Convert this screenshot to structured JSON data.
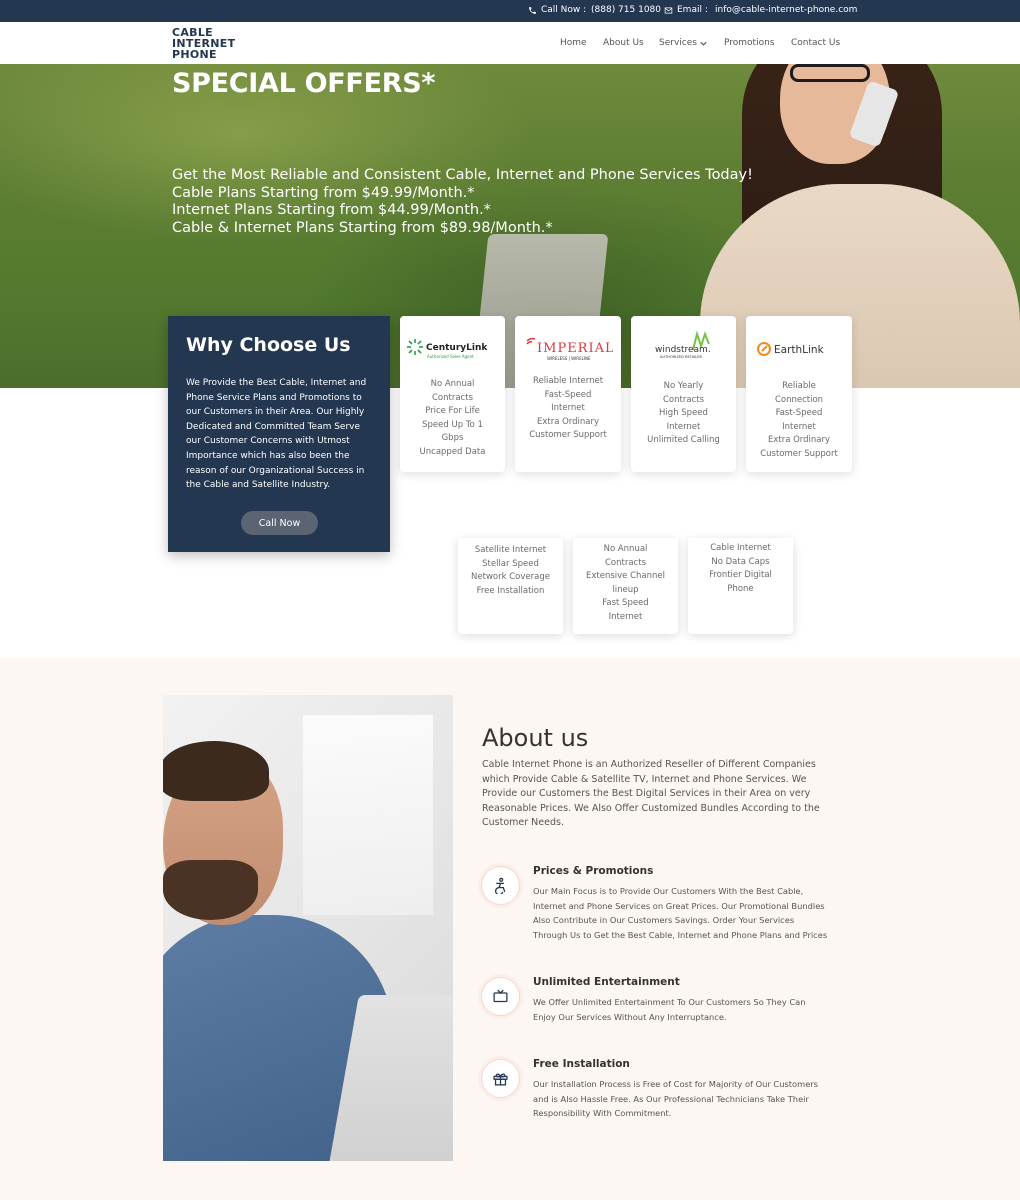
{
  "topbar": {
    "call_label": "Call Now :",
    "phone": "(888) 715 1080",
    "email_label": "Email :",
    "email": "info@cable-internet-phone.com"
  },
  "logo": {
    "line1": "CABLE",
    "line2": "INTERNET",
    "line3": "PHONE"
  },
  "nav": [
    {
      "label": "Home"
    },
    {
      "label": "About Us"
    },
    {
      "label": "Services"
    },
    {
      "label": "Promotions"
    },
    {
      "label": "Contact Us"
    }
  ],
  "hero": {
    "title": "SPECIAL OFFERS*",
    "line1": "Get the Most Reliable and Consistent Cable, Internet and Phone Services Today!",
    "line2": "Cable Plans Starting from $49.99/Month.*",
    "line3": "Internet Plans Starting from $44.99/Month.*",
    "line4": "Cable & Internet Plans Starting from $89.98/Month.*"
  },
  "why": {
    "title": "Why Choose Us",
    "text": "We Provide the Best Cable, Internet and Phone Service Plans and Promotions to our Customers in their Area. Our Highly Dedicated and Committed Team Serve our Customer Concerns with Utmost Importance which has also been the reason of our Organizational Success in the Cable and Satellite Industry.",
    "button": "Call Now"
  },
  "providers": [
    {
      "name": "CenturyLink",
      "sub": "Authorized Sales Agent",
      "features": [
        "No Annual",
        "Contracts",
        "Price For Life",
        "Speed Up To 1",
        "Gbps",
        "Uncapped Data"
      ]
    },
    {
      "name": "IMPERIAL",
      "sub": "WIRELESS | WIRELINE",
      "features": [
        "Reliable Internet",
        "Fast-Speed",
        "Internet",
        "Extra Ordinary",
        "Customer Support"
      ]
    },
    {
      "name": "windstream.",
      "sub": "AUTHORIZED RETAILER",
      "features": [
        "No Yearly",
        "Contracts",
        "High Speed",
        "Internet",
        "Unlimited Calling"
      ]
    },
    {
      "name": "EarthLink",
      "sub": "",
      "features": [
        "Reliable",
        "Connection",
        "Fast-Speed",
        "Internet",
        "Extra Ordinary",
        "Customer Support"
      ]
    }
  ],
  "providers_row2": [
    {
      "features": [
        "Satellite Internet",
        "Stellar Speed",
        "Network Coverage",
        "Free Installation"
      ]
    },
    {
      "features": [
        "No Annual",
        "Contracts",
        "Extensive Channel",
        "lineup",
        "Fast Speed",
        "Internet"
      ]
    },
    {
      "features": [
        "Cable Internet",
        "No Data Caps",
        "Frontier Digital",
        "Phone"
      ]
    }
  ],
  "about": {
    "title": "About us",
    "text": "Cable Internet Phone is an Authorized Reseller of Different Companies which Provide Cable & Satellite TV, Internet and Phone Services. We Provide our Customers the Best Digital Services in their Area on very Reasonable Prices. We Also Offer Customized Bundles According to the Customer Needs.",
    "features": [
      {
        "icon": "accessibility-icon",
        "title": "Prices & Promotions",
        "text": "Our Main Focus is to Provide Our Customers With the Best Cable, Internet and Phone Services on Great Prices. Our Promotional Bundles Also Contribute in Our Customers Savings. Order Your Services Through Us to Get the Best Cable, Internet and Phone Plans and Prices"
      },
      {
        "icon": "tv-icon",
        "title": "Unlimited Entertainment",
        "text": "We Offer Unlimited Entertainment To Our Customers So They Can Enjoy Our Services Without Any Interruptance."
      },
      {
        "icon": "gift-icon",
        "title": "Free Installation",
        "text": "Our Installation Process is Free of Cost for Majority of Our Customers and is Also Hassle Free. As Our Professional Technicians Take Their Responsibility With Commitment."
      }
    ]
  },
  "colors": {
    "navy": "#243750",
    "accent_red": "#d93a3a",
    "windstream_green": "#7ac143",
    "earthlink_orange": "#f28c1c",
    "centurylink_green": "#2a9c48"
  }
}
